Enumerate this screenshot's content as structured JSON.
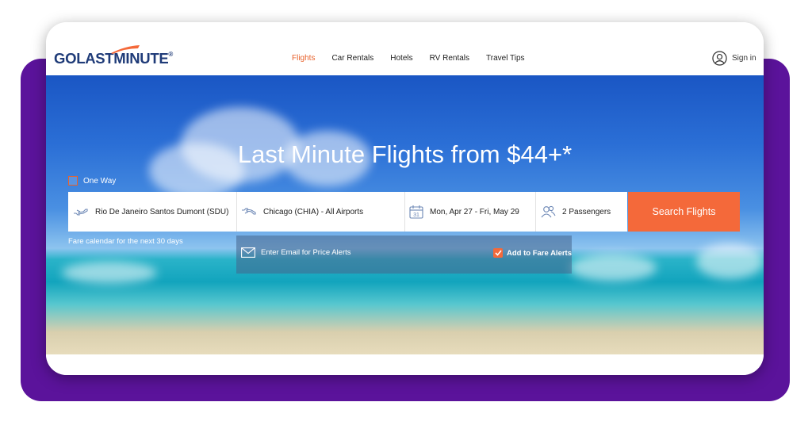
{
  "brand": {
    "logo_go": "GO",
    "logo_last": "LAST",
    "logo_minute": "MINUTE",
    "logo_registered": "®",
    "accent_color": "#f4693a",
    "brand_color": "#1f3b78",
    "frame_color": "#5b139b"
  },
  "nav": {
    "items": [
      {
        "label": "Flights",
        "active": true
      },
      {
        "label": "Car Rentals",
        "active": false
      },
      {
        "label": "Hotels",
        "active": false
      },
      {
        "label": "RV Rentals",
        "active": false
      },
      {
        "label": "Travel Tips",
        "active": false
      }
    ]
  },
  "account": {
    "signin_label": "Sign in",
    "icon": "user-circle-icon"
  },
  "hero": {
    "title": "Last Minute Flights from $44+*"
  },
  "search": {
    "one_way_label": "One Way",
    "one_way_checked": false,
    "origin": "Rio De Janeiro Santos Dumont (SDU)",
    "destination": "Chicago (CHIA) - All Airports",
    "dates": "Mon, Apr 27 - Fri, May 29",
    "calendar_day": "31",
    "passengers": "2 Passengers",
    "search_button": "Search Flights",
    "fare_calendar_text": "Fare calendar for the next 30 days"
  },
  "alerts": {
    "email_placeholder": "Enter Email for Price Alerts",
    "add_label": "Add to Fare Alerts",
    "add_checked": true
  }
}
